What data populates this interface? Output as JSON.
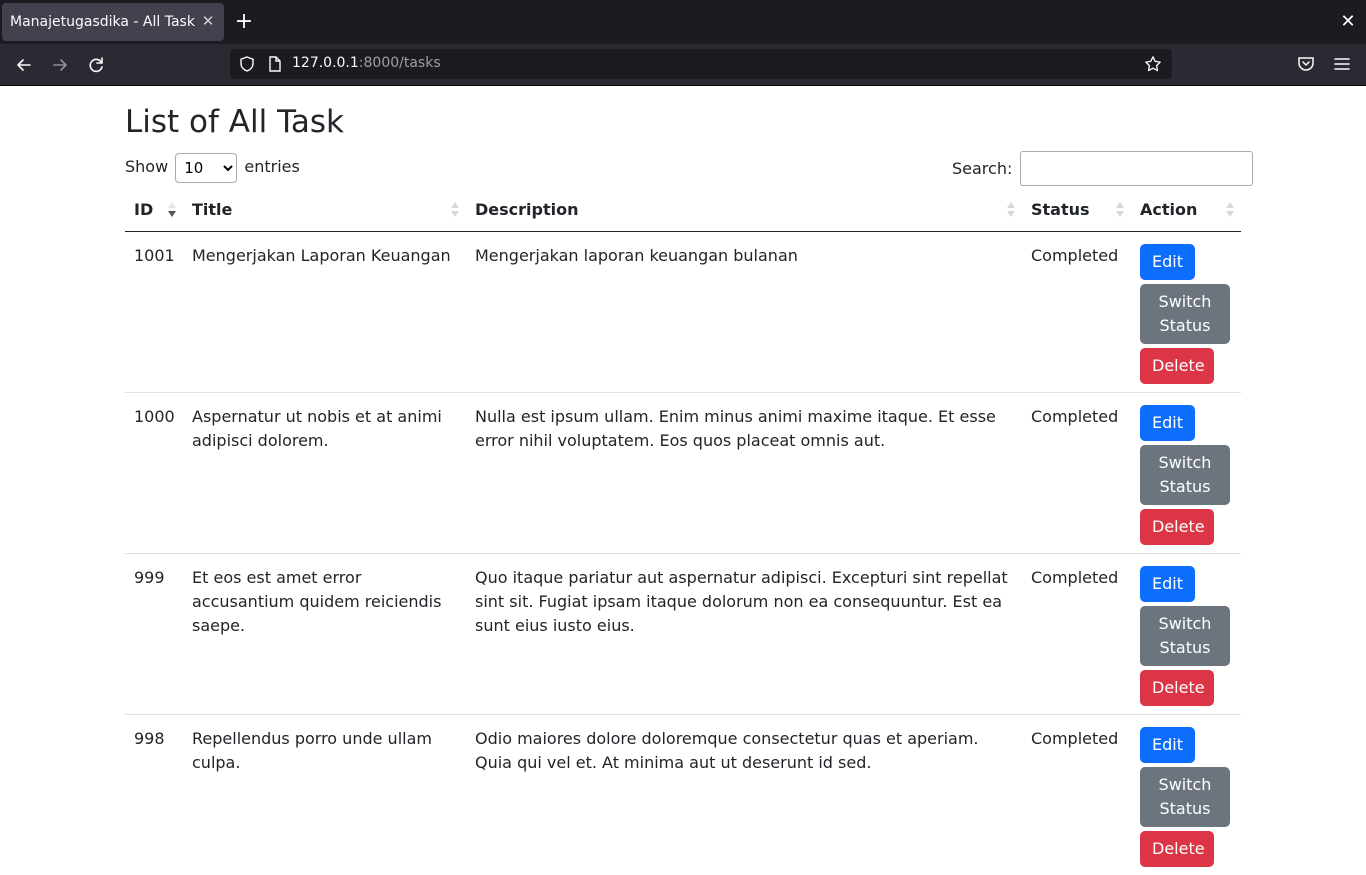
{
  "browser": {
    "tab_title": "Manajetugasdika - All Task",
    "url_host": "127.0.0.1",
    "url_rest": ":8000/tasks"
  },
  "page": {
    "title": "List of All Task",
    "show_label": "Show",
    "entries_label": "entries",
    "length_selected": "10",
    "search_label": "Search:"
  },
  "table": {
    "headers": {
      "id": "ID",
      "title": "Title",
      "description": "Description",
      "status": "Status",
      "action": "Action"
    },
    "buttons": {
      "edit": "Edit",
      "switch": "Switch Status",
      "delete": "Delete"
    },
    "rows": [
      {
        "id": "1001",
        "title": "Mengerjakan Laporan Keuangan",
        "description": "Mengerjakan laporan keuangan bulanan",
        "status": "Completed"
      },
      {
        "id": "1000",
        "title": "Aspernatur ut nobis et at animi adipisci dolorem.",
        "description": "Nulla est ipsum ullam. Enim minus animi maxime itaque. Et esse error nihil voluptatem. Eos quos placeat omnis aut.",
        "status": "Completed"
      },
      {
        "id": "999",
        "title": "Et eos est amet error accusantium quidem reiciendis saepe.",
        "description": "Quo itaque pariatur aut aspernatur adipisci. Excepturi sint repellat sint sit. Fugiat ipsam itaque dolorum non ea consequuntur. Est ea sunt eius iusto eius.",
        "status": "Completed"
      },
      {
        "id": "998",
        "title": "Repellendus porro unde ullam culpa.",
        "description": "Odio maiores dolore doloremque consectetur quas et aperiam. Quia qui vel et. At minima aut ut deserunt id sed.",
        "status": "Completed"
      }
    ]
  },
  "colors": {
    "edit": "#0d6efd",
    "switch": "#6c757d",
    "delete": "#dc3545"
  }
}
